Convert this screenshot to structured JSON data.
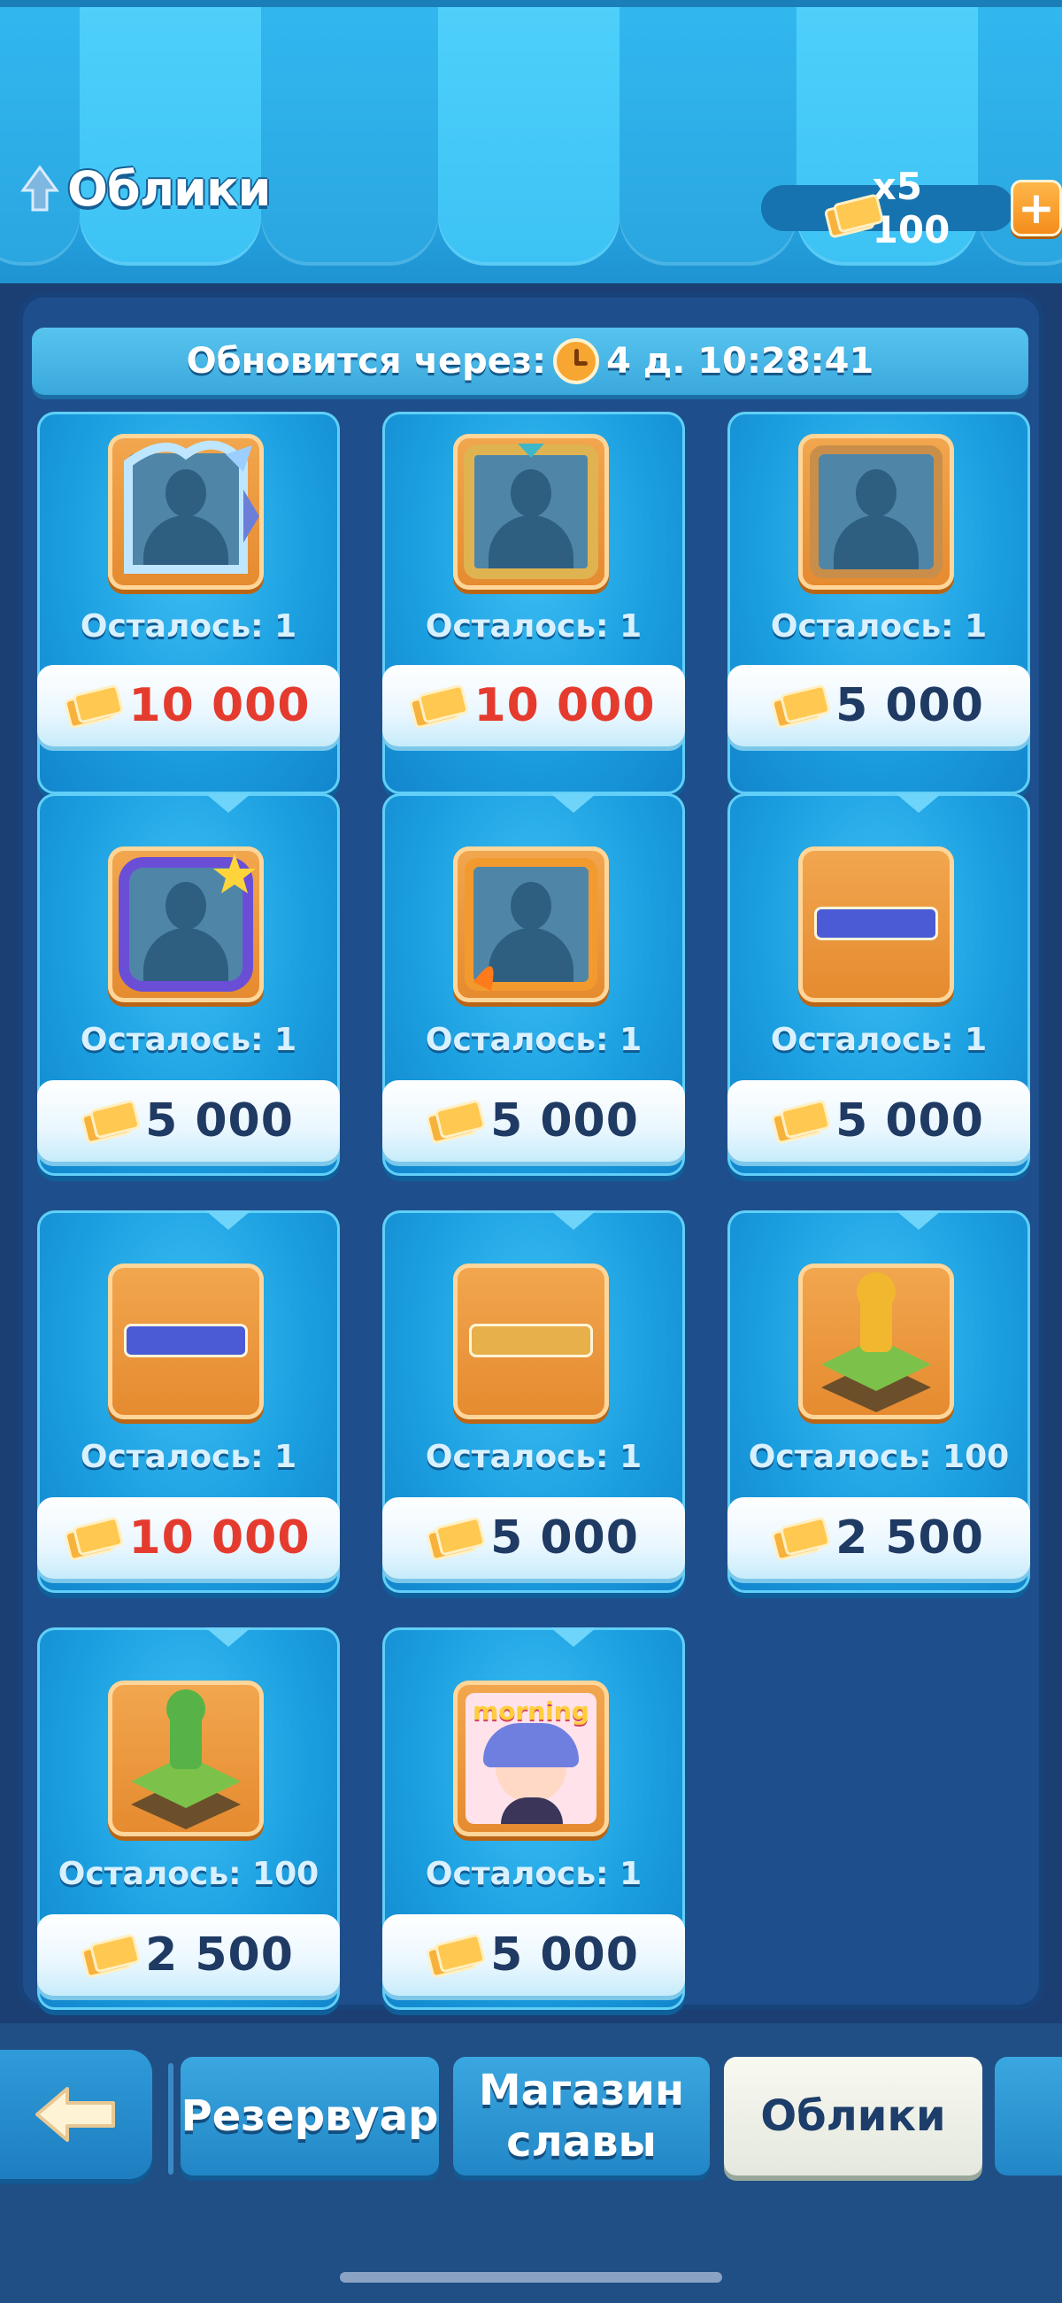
{
  "header": {
    "title": "Облики",
    "currency_amount": "x5 100",
    "add_label": "+"
  },
  "refresh": {
    "label": "Обновится через:",
    "time": "4 д. 10:28:41"
  },
  "items": [
    {
      "remaining": "Осталось: 1",
      "price": "10 000",
      "price_color": "#e53b2f",
      "art": "dragon-frame"
    },
    {
      "remaining": "Осталось: 1",
      "price": "10 000",
      "price_color": "#e53b2f",
      "art": "gold-frame"
    },
    {
      "remaining": "Осталось: 1",
      "price": "5 000",
      "price_color": "#1f3a63",
      "art": "bronze-frame"
    },
    {
      "remaining": "Осталось: 1",
      "price": "5 000",
      "price_color": "#1f3a63",
      "art": "star-frame"
    },
    {
      "remaining": "Осталось: 1",
      "price": "5 000",
      "price_color": "#1f3a63",
      "art": "flame-frame"
    },
    {
      "remaining": "Осталось: 1",
      "price": "5 000",
      "price_color": "#1f3a63",
      "art": "star-nameplate"
    },
    {
      "remaining": "Осталось: 1",
      "price": "10 000",
      "price_color": "#e53b2f",
      "art": "crystal-nameplate"
    },
    {
      "remaining": "Осталось: 1",
      "price": "5 000",
      "price_color": "#1f3a63",
      "art": "snail-nameplate"
    },
    {
      "remaining": "Осталось: 100",
      "price": "2 500",
      "price_color": "#1f3a63",
      "art": "trophy-tile"
    },
    {
      "remaining": "Осталось: 100",
      "price": "2 500",
      "price_color": "#1f3a63",
      "art": "garden-tile"
    },
    {
      "remaining": "Осталось: 1",
      "price": "5 000",
      "price_color": "#1f3a63",
      "art": "morning-sticker"
    }
  ],
  "sticker_text": "morning",
  "tabs": {
    "reservoir": "Резервуар",
    "fame_shop": "Магазин славы",
    "skins": "Облики"
  }
}
